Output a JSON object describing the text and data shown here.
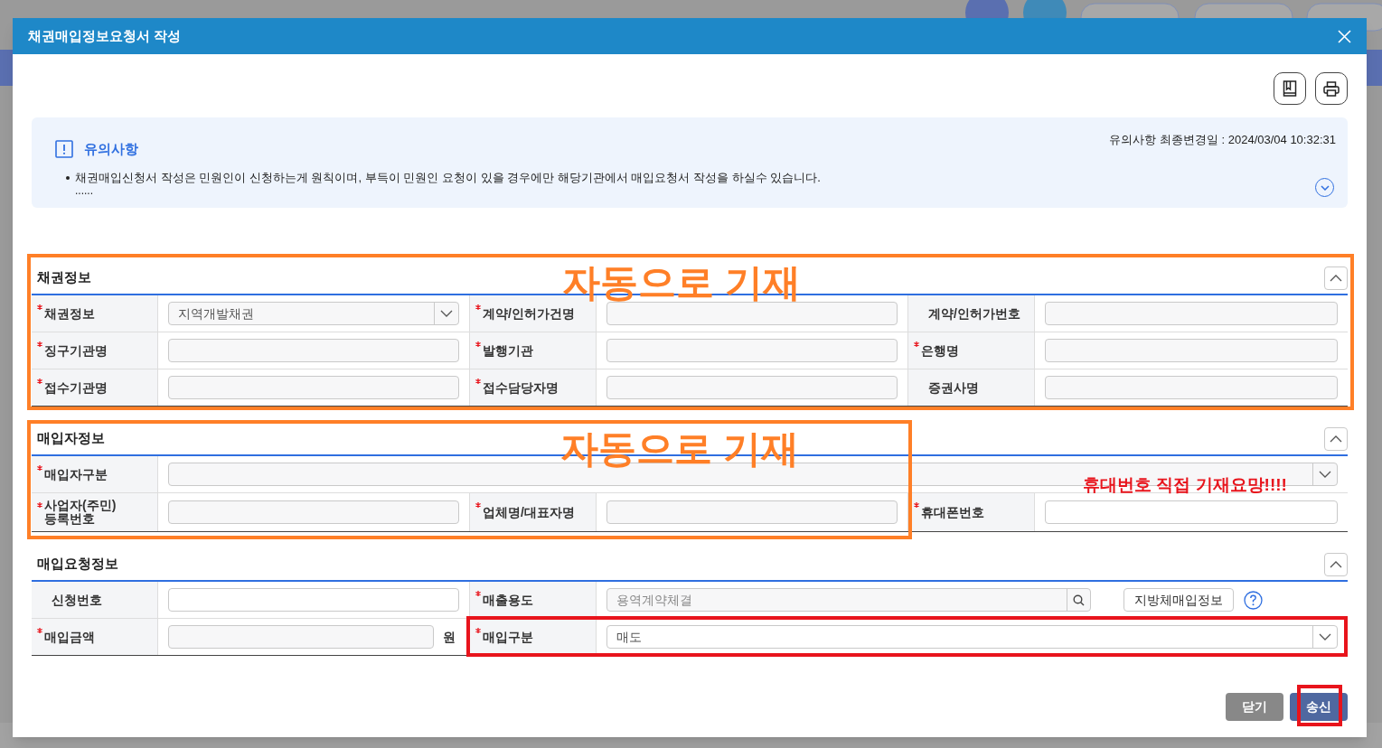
{
  "dialog": {
    "title": "채권매입정보요청서 작성"
  },
  "notice": {
    "title": "유의사항",
    "updated": "유의사항 최종변경일 : 2024/03/04 10:32:31",
    "bullets": [
      "채권매입신청서 작성은 민원인이 신청하는게 원칙이며, 부득이 민원인 요청이 있을 경우에만 해당기관에서 매입요청서 작성을 하실수 있습니다."
    ],
    "more": "......",
    "expanded": false
  },
  "sections": [
    {
      "title": "채권정보",
      "expanded": true,
      "rows": [
        [
          {
            "label": "채권정보",
            "required": true,
            "kind": "select",
            "value": "지역개발채권",
            "readonly": true
          },
          {
            "label": "계약/인허가건명",
            "required": true,
            "kind": "text",
            "readonly": true
          },
          {
            "label": "계약/인허가번호",
            "required": false,
            "kind": "text",
            "readonly": true
          }
        ],
        [
          {
            "label": "징구기관명",
            "required": true,
            "kind": "text",
            "readonly": true
          },
          {
            "label": "발행기관",
            "required": true,
            "kind": "text",
            "readonly": true
          },
          {
            "label": "은행명",
            "required": true,
            "kind": "text",
            "readonly": true
          }
        ],
        [
          {
            "label": "접수기관명",
            "required": true,
            "kind": "text",
            "readonly": true
          },
          {
            "label": "접수담당자명",
            "required": true,
            "kind": "text",
            "readonly": true
          },
          {
            "label": "증권사명",
            "required": false,
            "kind": "text",
            "readonly": true
          }
        ]
      ]
    },
    {
      "title": "매입자정보",
      "expanded": true,
      "rows": [
        [
          {
            "label": "매입자구분",
            "required": true,
            "kind": "select",
            "readonly": true
          }
        ],
        [
          {
            "label": "사업자(주민)\n등록번호",
            "required": true,
            "kind": "text",
            "readonly": true
          },
          {
            "label": "업체명/대표자명",
            "required": true,
            "kind": "text",
            "readonly": true
          },
          {
            "label": "휴대폰번호",
            "required": true,
            "kind": "text",
            "readonly": false
          }
        ]
      ]
    },
    {
      "title": "매입요청정보",
      "expanded": true,
      "rows": [
        [
          {
            "label": "신청번호",
            "required": false,
            "kind": "text",
            "readonly": false
          },
          {
            "label": "매출용도",
            "required": true,
            "kind": "search",
            "placeholder": "용역계약체결",
            "readonly": true,
            "button": "지방체매입정보"
          }
        ],
        [
          {
            "label": "매입금액",
            "required": true,
            "kind": "unit",
            "unit": "원",
            "readonly": true
          },
          {
            "label": "매입구분",
            "required": true,
            "kind": "select",
            "value": "매도",
            "readonly": false
          }
        ]
      ]
    }
  ],
  "buttons": [
    {
      "label": "닫기",
      "kind": "secondary"
    },
    {
      "label": "송신",
      "kind": "primary"
    }
  ],
  "annotations": [
    {
      "kind": "box",
      "color": "#ff7f27"
    },
    {
      "kind": "box",
      "color": "#ff7f27"
    },
    {
      "kind": "text",
      "text": "자동으로 기재",
      "color": "#ff7f27"
    },
    {
      "kind": "text",
      "text": "자동으로 기재",
      "color": "#ff7f27"
    },
    {
      "kind": "text",
      "text": "휴대번호 직접 기재요망!!!!",
      "color": "#e8141c"
    },
    {
      "kind": "box",
      "color": "#e8141c"
    },
    {
      "kind": "box",
      "color": "#e8141c"
    }
  ]
}
